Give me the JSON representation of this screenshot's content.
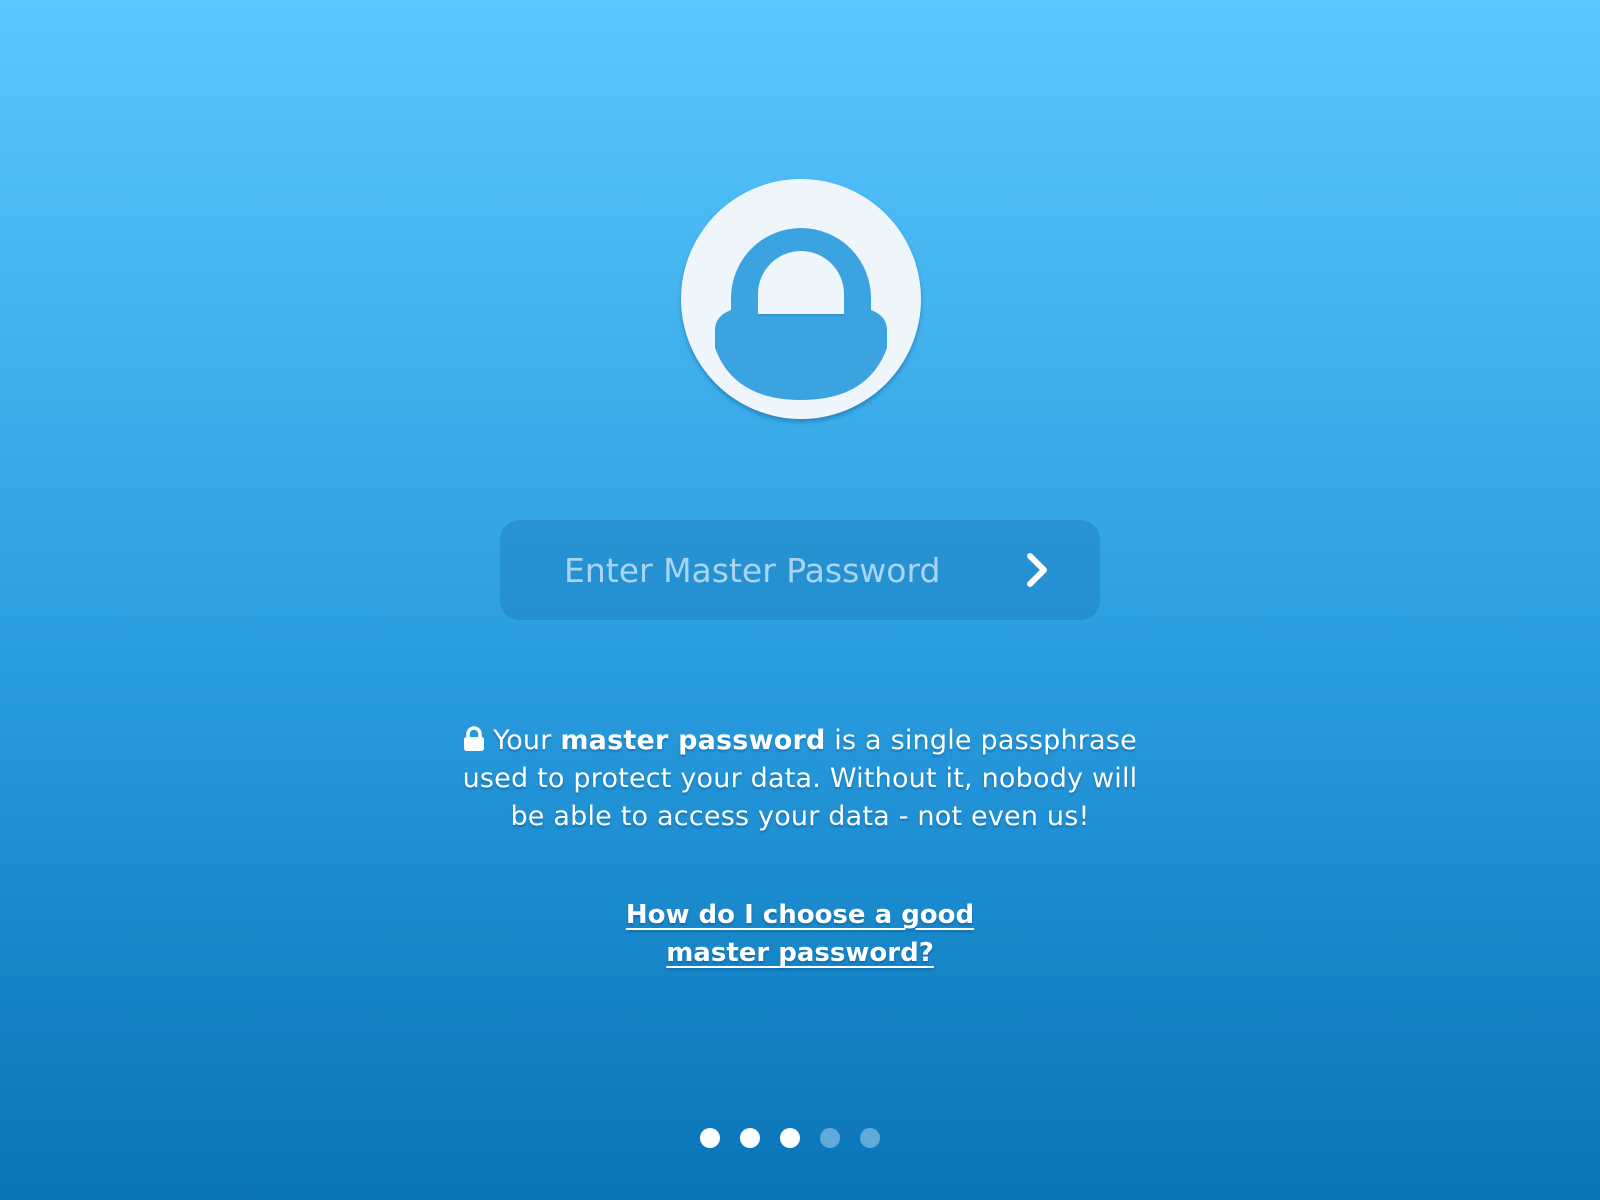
{
  "password_field": {
    "placeholder": "Enter Master Password",
    "value": ""
  },
  "submit": {
    "icon": "chevron-right-icon"
  },
  "logo": {
    "icon": "padlock-logo-icon",
    "background_color": "#eef6fc",
    "accent_color": "#3aa3e0"
  },
  "info": {
    "icon": "lock-icon",
    "text_before": "Your ",
    "bold": "master password",
    "text_after": " is a single passphrase used to protect your data. Without it, nobody will be able to access your data - not even us!"
  },
  "help_link": {
    "line1": "How do I choose a good",
    "line2": "master password?"
  },
  "pagination": {
    "total": 5,
    "dots": [
      {
        "state": "active"
      },
      {
        "state": "active"
      },
      {
        "state": "active"
      },
      {
        "state": "inactive"
      },
      {
        "state": "inactive"
      }
    ]
  },
  "colors": {
    "gradient_top": "#5ac8ff",
    "gradient_bottom": "#0a74b7",
    "text": "#ffffff"
  }
}
